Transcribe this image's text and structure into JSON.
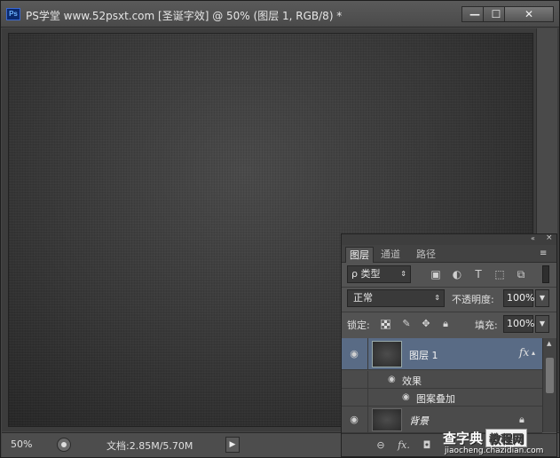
{
  "window": {
    "app_icon_label": "Ps",
    "title": "PS学堂 www.52psxt.com [圣诞字效] @ 50% (图层 1, RGB/8) *",
    "min_label": "—",
    "max_label": "☐",
    "close_label": "✕"
  },
  "statusbar": {
    "zoom": "50%",
    "doc_info": "文档:2.85M/5.70M",
    "arrow": "▶"
  },
  "layers_panel": {
    "collapse_glyph": "«",
    "close_glyph": "×",
    "menu_glyph": "≡",
    "tabs": [
      {
        "label": "图层",
        "active": true
      },
      {
        "label": "通道",
        "active": false
      },
      {
        "label": "路径",
        "active": false
      }
    ],
    "filter": {
      "label": "类型",
      "prefix": "ρ"
    },
    "blend_mode": "正常",
    "opacity_label": "不透明度:",
    "opacity_value": "100%",
    "lock_label": "锁定:",
    "fill_label": "填充:",
    "fill_value": "100%",
    "layers": [
      {
        "name": "图层 1",
        "fx": "fx",
        "selected": true
      },
      {
        "name": "背景",
        "locked": true
      }
    ],
    "effects": {
      "group_label": "效果",
      "items": [
        "图案叠加"
      ]
    }
  },
  "watermark": {
    "main": "查字典",
    "box": "教程网",
    "url": "jiaocheng.chazidian.com"
  },
  "colors": {
    "selected_layer": "#596b85",
    "ps_icon_bg": "#0b2a6e"
  }
}
